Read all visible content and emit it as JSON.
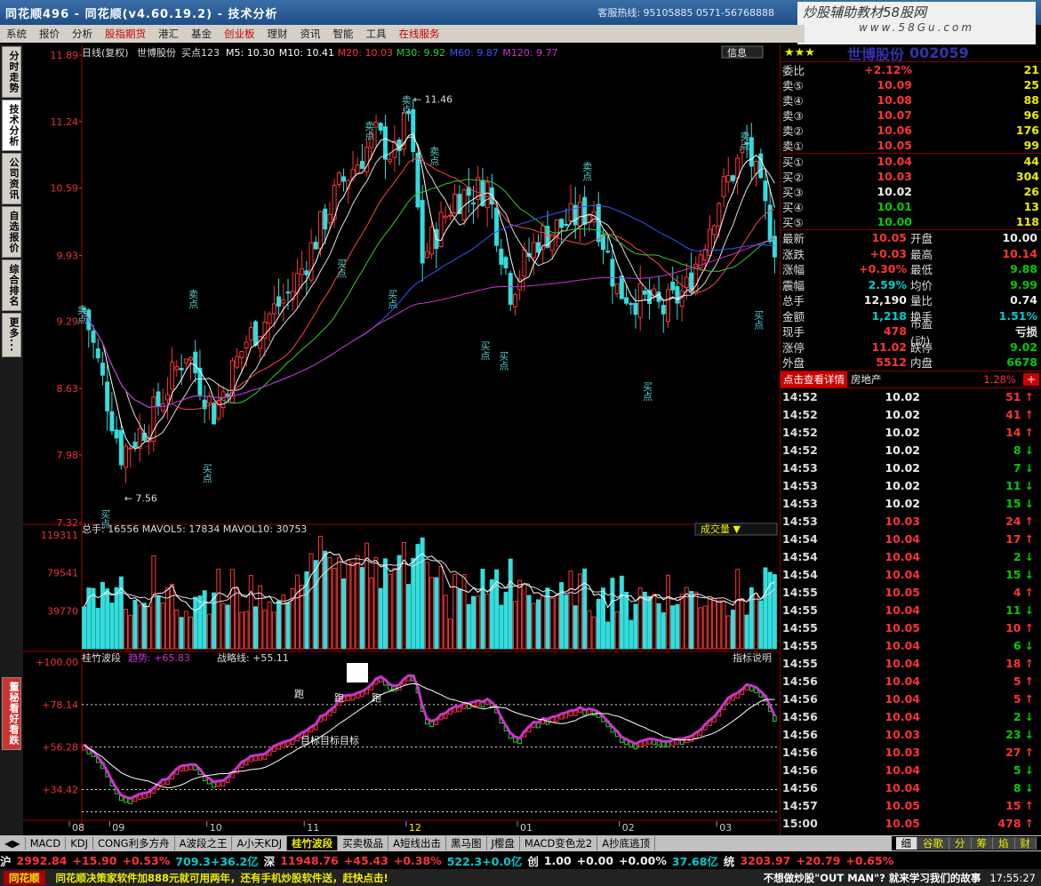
{
  "window": {
    "title": "同花顺496 - 同花顺(v4.60.19.2) - 技术分析",
    "hotline": "客服热线: 95105885 0571-56768888",
    "watermark": "炒股辅助教材58股网",
    "watermark_url": "www.58Gu.com"
  },
  "menubar": [
    "系统",
    "报价",
    "分析",
    "股指期货",
    "港汇",
    "基金",
    "创业板",
    "理财",
    "资讯",
    "智能",
    "工具",
    "在线服务"
  ],
  "sidetabs": [
    "分时走势",
    "技术分析",
    "公司资讯",
    "自选报价",
    "综合排名",
    "更多..."
  ],
  "sidetab_bottom": "董秘看好看跌",
  "chart_header": {
    "period": "日线(复权)",
    "stock": "世博股份",
    "signal": "买点123",
    "ma": [
      {
        "label": "M5: 10.30",
        "color": "#ffffff"
      },
      {
        "label": "M10: 10.41",
        "color": "#ffffff"
      },
      {
        "label": "M20: 10.03",
        "color": "#ff3333"
      },
      {
        "label": "M30: 9.92",
        "color": "#33cc33"
      },
      {
        "label": "M60: 9.87",
        "color": "#3355ff"
      },
      {
        "label": "M120: 9.77",
        "color": "#cc33cc"
      }
    ],
    "info_button": "信息"
  },
  "price_axis": [
    "11.89",
    "11.24",
    "10.59",
    "9.93",
    "9.29",
    "8.63",
    "7.98",
    "7.32"
  ],
  "price_annotations": {
    "high": "11.46",
    "low": "7.56",
    "sell": "卖点",
    "buy": "买点"
  },
  "volume_header": {
    "text": "总手: 16556 MAVOL5: 17834 MAVOL10: 30753",
    "dropdown": "成交量"
  },
  "volume_axis": [
    "119311",
    "79541",
    "39770"
  ],
  "indicator_header": {
    "name": "桂竹波段",
    "trend": "趋势: +65.83",
    "strategy": "战略线: +55.11",
    "help": "指标说明"
  },
  "indicator_axis": [
    "+100.00",
    "+78.14",
    "+56.28",
    "+34.42"
  ],
  "indicator_labels": {
    "run1": "跑",
    "run2": "跑",
    "run3": "跑",
    "target": "目标目标目标"
  },
  "month_axis": [
    {
      "label": "08",
      "color": "#cccccc"
    },
    {
      "label": "09",
      "color": "#cccccc"
    },
    {
      "label": "10",
      "color": "#cccccc"
    },
    {
      "label": "11",
      "color": "#cccccc"
    },
    {
      "label": "12",
      "color": "#ffee00"
    },
    {
      "label": "01",
      "color": "#cccccc"
    },
    {
      "label": "02",
      "color": "#cccccc"
    },
    {
      "label": "03",
      "color": "#cccccc"
    }
  ],
  "right_panel": {
    "stock_name": "世博股份",
    "stock_code": "002059",
    "weibi": {
      "label": "委比",
      "value": "+2.12%",
      "vol": "21"
    },
    "asks": [
      {
        "label": "卖⑤",
        "price": "10.09",
        "vol": "25"
      },
      {
        "label": "卖④",
        "price": "10.08",
        "vol": "88"
      },
      {
        "label": "卖③",
        "price": "10.07",
        "vol": "96"
      },
      {
        "label": "卖②",
        "price": "10.06",
        "vol": "176"
      },
      {
        "label": "卖①",
        "price": "10.05",
        "vol": "99"
      }
    ],
    "bids": [
      {
        "label": "买①",
        "price": "10.04",
        "vol": "44"
      },
      {
        "label": "买②",
        "price": "10.03",
        "vol": "304"
      },
      {
        "label": "买③",
        "price": "10.02",
        "vol": "26"
      },
      {
        "label": "买④",
        "price": "10.01",
        "vol": "13"
      },
      {
        "label": "买⑤",
        "price": "10.00",
        "vol": "118"
      }
    ],
    "stats": [
      {
        "l1": "最新",
        "v1": "10.05",
        "c1": "red",
        "l2": "开盘",
        "v2": "10.00",
        "c2": "wht"
      },
      {
        "l1": "涨跌",
        "v1": "+0.03",
        "c1": "red",
        "l2": "最高",
        "v2": "10.14",
        "c2": "red"
      },
      {
        "l1": "涨幅",
        "v1": "+0.30%",
        "c1": "red",
        "l2": "最低",
        "v2": "9.88",
        "c2": "grn"
      },
      {
        "l1": "震幅",
        "v1": "2.59%",
        "c1": "cyn",
        "l2": "均价",
        "v2": "9.99",
        "c2": "grn"
      },
      {
        "l1": "总手",
        "v1": "12,190",
        "c1": "wht",
        "l2": "量比",
        "v2": "0.74",
        "c2": "wht"
      },
      {
        "l1": "金额",
        "v1": "1,218",
        "c1": "cyn",
        "l2": "换手",
        "v2": "1.51%",
        "c2": "cyn"
      },
      {
        "l1": "现手",
        "v1": "478",
        "c1": "red",
        "l2": "市盈(动)",
        "v2": "亏损",
        "c2": "wht"
      },
      {
        "l1": "涨停",
        "v1": "11.02",
        "c1": "red",
        "l2": "跌停",
        "v2": "9.02",
        "c2": "grn"
      },
      {
        "l1": "外盘",
        "v1": "5512",
        "c1": "red",
        "l2": "内盘",
        "v2": "6678",
        "c2": "grn"
      }
    ],
    "detail_button": "点击查看详情",
    "sector": "房地产",
    "sector_change": "1.28%",
    "ticks": [
      {
        "t": "14:52",
        "p": "10.02",
        "v": "51",
        "c": "wht",
        "d": "up"
      },
      {
        "t": "14:52",
        "p": "10.02",
        "v": "41",
        "c": "wht",
        "d": "up"
      },
      {
        "t": "14:52",
        "p": "10.02",
        "v": "14",
        "c": "wht",
        "d": "up"
      },
      {
        "t": "14:52",
        "p": "10.02",
        "v": "8",
        "c": "wht",
        "d": "down"
      },
      {
        "t": "14:53",
        "p": "10.02",
        "v": "7",
        "c": "wht",
        "d": "down"
      },
      {
        "t": "14:53",
        "p": "10.02",
        "v": "11",
        "c": "wht",
        "d": "down"
      },
      {
        "t": "14:53",
        "p": "10.02",
        "v": "15",
        "c": "wht",
        "d": "down"
      },
      {
        "t": "14:53",
        "p": "10.03",
        "v": "24",
        "c": "red",
        "d": "up"
      },
      {
        "t": "14:54",
        "p": "10.04",
        "v": "17",
        "c": "red",
        "d": "up"
      },
      {
        "t": "14:54",
        "p": "10.04",
        "v": "2",
        "c": "red",
        "d": "down"
      },
      {
        "t": "14:54",
        "p": "10.04",
        "v": "15",
        "c": "red",
        "d": "down"
      },
      {
        "t": "14:55",
        "p": "10.05",
        "v": "4",
        "c": "red",
        "d": "up"
      },
      {
        "t": "14:55",
        "p": "10.04",
        "v": "11",
        "c": "red",
        "d": "down"
      },
      {
        "t": "14:55",
        "p": "10.05",
        "v": "10",
        "c": "red",
        "d": "up"
      },
      {
        "t": "14:55",
        "p": "10.04",
        "v": "6",
        "c": "red",
        "d": "down"
      },
      {
        "t": "14:55",
        "p": "10.04",
        "v": "18",
        "c": "red",
        "d": "up"
      },
      {
        "t": "14:56",
        "p": "10.04",
        "v": "5",
        "c": "red",
        "d": "up"
      },
      {
        "t": "14:56",
        "p": "10.04",
        "v": "5",
        "c": "red",
        "d": "up"
      },
      {
        "t": "14:56",
        "p": "10.04",
        "v": "2",
        "c": "red",
        "d": "down"
      },
      {
        "t": "14:56",
        "p": "10.03",
        "v": "23",
        "c": "red",
        "d": "down"
      },
      {
        "t": "14:56",
        "p": "10.03",
        "v": "27",
        "c": "red",
        "d": "up"
      },
      {
        "t": "14:56",
        "p": "10.04",
        "v": "5",
        "c": "red",
        "d": "down"
      },
      {
        "t": "14:56",
        "p": "10.04",
        "v": "8",
        "c": "red",
        "d": "down"
      },
      {
        "t": "14:57",
        "p": "10.05",
        "v": "15",
        "c": "red",
        "d": "up"
      },
      {
        "t": "15:00",
        "p": "10.05",
        "v": "478",
        "c": "red",
        "d": "up"
      }
    ],
    "tabs": [
      "细",
      "谷歌",
      "分",
      "筹",
      "焰",
      "财"
    ]
  },
  "bottom_tabs": [
    "MACD",
    "KDJ",
    "CONG利多方舟",
    "A波段之王",
    "A小天KDJ",
    "桂竹波段",
    "买卖极品",
    "A短线出击",
    "黑马图",
    "J樱盘",
    "MACD变色龙2",
    "A抄底逃顶"
  ],
  "bottom_tabs_active": 5,
  "index_bar": [
    {
      "text": "沪",
      "c": "wht"
    },
    {
      "text": "2992.84",
      "c": "red"
    },
    {
      "text": "+15.90",
      "c": "red"
    },
    {
      "text": "+0.53%",
      "c": "red"
    },
    {
      "text": "709.3+36.2亿",
      "c": "cyn"
    },
    {
      "text": "深",
      "c": "wht"
    },
    {
      "text": "11948.76",
      "c": "red"
    },
    {
      "text": "+45.43",
      "c": "red"
    },
    {
      "text": "+0.38%",
      "c": "red"
    },
    {
      "text": "522.3+0.0亿",
      "c": "cyn"
    },
    {
      "text": "创",
      "c": "wht"
    },
    {
      "text": "1.00",
      "c": "wht"
    },
    {
      "text": "+0.00",
      "c": "wht"
    },
    {
      "text": "+0.00%",
      "c": "wht"
    },
    {
      "text": "37.68亿",
      "c": "cyn"
    },
    {
      "text": "统",
      "c": "wht"
    },
    {
      "text": "3203.97",
      "c": "red"
    },
    {
      "text": "+20.79",
      "c": "red"
    },
    {
      "text": "+0.65%",
      "c": "red"
    }
  ],
  "status_bar": {
    "brand": "同花顺",
    "ad1": "同花顺决策家软件加888元就可用两年，还有手机炒股软件送，赶快点击!",
    "ad2": "不想做炒股\"OUT MAN\"? 就来学习我们的故事",
    "time": "17:55:27"
  },
  "chart_data": {
    "type": "candlestick",
    "title": "日线(复权) 世博股份",
    "price_range": [
      7.32,
      11.89
    ],
    "volume_range": [
      0,
      119311
    ],
    "indicator_range": [
      20,
      100
    ],
    "months": [
      "08",
      "09",
      "10",
      "11",
      "12",
      "01",
      "02",
      "03"
    ],
    "indicator_levels": [
      78.14,
      56.28,
      34.42,
      23
    ]
  }
}
